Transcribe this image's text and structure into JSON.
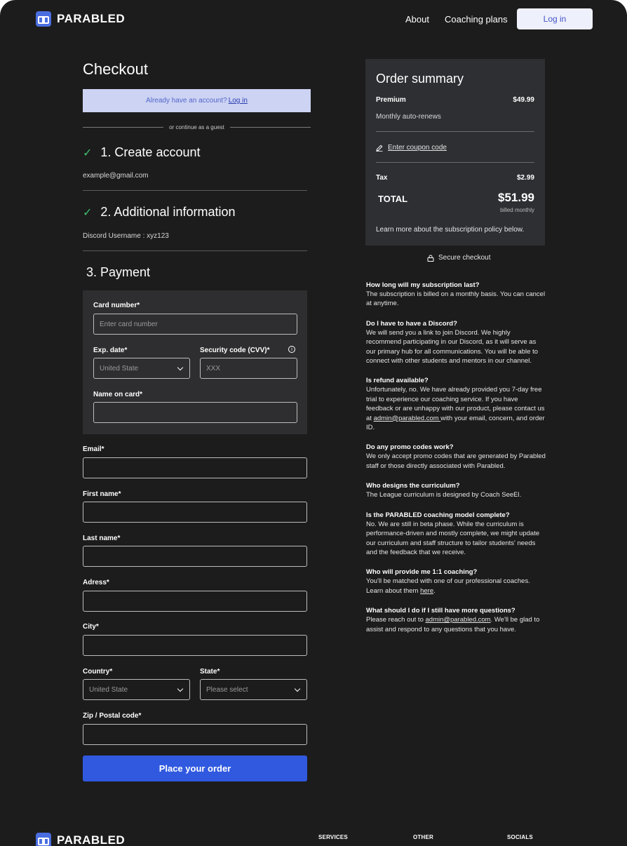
{
  "nav": {
    "brand": "PARABLED",
    "links": [
      "About",
      "Coaching plans"
    ],
    "login_label": "Log in"
  },
  "checkout": {
    "title": "Checkout",
    "account_prompt": "Already have an account?",
    "account_login": "Log in",
    "guest_divider": "or continue as a guest",
    "step1": {
      "title": "1. Create account",
      "value": "example@gmail.com"
    },
    "step2": {
      "title": "2. Additional information",
      "value": "Discord Username : xyz123"
    },
    "step3": {
      "title": "3. Payment"
    },
    "card": {
      "number_label": "Card number*",
      "number_placeholder": "Enter card number",
      "exp_label": "Exp. date*",
      "exp_value": "United State",
      "cvv_label": "Security code (CVV)*",
      "cvv_placeholder": "XXX",
      "name_label": "Name on card*",
      "name_value": ""
    },
    "fields": {
      "email_label": "Email*",
      "first_name_label": "First name*",
      "last_name_label": "Last name*",
      "address_label": "Adress*",
      "city_label": "City*",
      "country_label": "Country*",
      "country_value": "United State",
      "state_label": "State*",
      "state_value": "Please select",
      "zip_label": "Zip / Postal code*"
    },
    "submit_label": "Place your order"
  },
  "summary": {
    "title": "Order summary",
    "plan_name": "Premium",
    "plan_price": "$49.99",
    "plan_note": "Monthly auto-renews",
    "coupon_label": "Enter coupon code",
    "tax_label": "Tax",
    "tax_value": "$2.99",
    "total_label": "TOTAL",
    "total_value": "$51.99",
    "billed_note": "billed monthly",
    "policy_note": "Learn more about the subscription policy below.",
    "secure_label": "Secure checkout"
  },
  "faq": [
    {
      "q": "How long will my subscription last?",
      "a": "The subscription is billed on a monthly basis. You can cancel at anytime."
    },
    {
      "q": "Do I have to have a Discord?",
      "a": "We will send you a link to join Discord. We highly recommend participating in our Discord, as it will serve as our primary hub for all communications. You will be able to connect with other students and mentors in our channel."
    },
    {
      "q": "Is refund available?",
      "a_pre": "Unfortunately, no. We have already provided you 7-day free trial to experience our coaching service. If you have feedback or are unhappy with our product, please contact us at ",
      "a_link": "admin@parabled.com ",
      "a_post": "with your email, concern, and order ID."
    },
    {
      "q": "Do any promo codes work?",
      "a": "We only accept promo codes that are generated by Parabled staff or those directly associated with Parabled."
    },
    {
      "q": "Who designs the curriculum?",
      "a": "The League curriculum is designed by Coach SeeEl."
    },
    {
      "q": "Is the PARABLED coaching model complete?",
      "a": "No. We are still in beta phase. While the curriculum is performance-driven and mostly complete, we might update our curriculum and staff structure to tailor students' needs and the feedback that we receive."
    },
    {
      "q": "Who will provide me 1:1 coaching?",
      "a_pre": "You'll be matched with one of our professional coaches. Learn about them ",
      "a_link": "here",
      "a_post": "."
    },
    {
      "q": "What should I do if I still have more questions?",
      "a_pre": "Please reach out to ",
      "a_link": "admin@parabled.com",
      "a_post": ". We'll be glad to assist and respond to any questions that you have."
    }
  ],
  "footer": {
    "brand": "PARABLED",
    "columns": [
      "SERVICES",
      "OTHER",
      "SOCIALS"
    ]
  },
  "colors": {
    "background": "#1c1c1c",
    "panel": "#2e2f33",
    "accent": "#3059e0",
    "banner": "#ccd3f3",
    "check": "#3fbf6e"
  }
}
